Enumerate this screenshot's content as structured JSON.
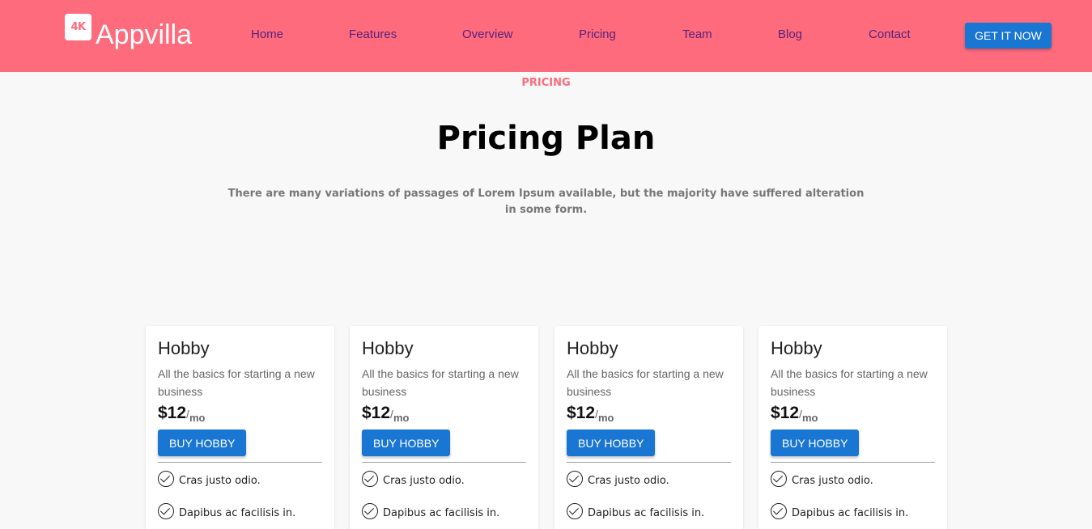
{
  "brand": {
    "logo_text": "4K",
    "name": "Appvilla"
  },
  "nav": {
    "items": [
      {
        "label": "Home"
      },
      {
        "label": "Features"
      },
      {
        "label": "Overview"
      },
      {
        "label": "Pricing"
      },
      {
        "label": "Team"
      },
      {
        "label": "Blog"
      },
      {
        "label": "Contact"
      }
    ],
    "cta_label": "GET IT NOW"
  },
  "section": {
    "eyebrow": "PRICING",
    "title": "Pricing Plan",
    "subtitle": "There are many variations of passages of Lorem Ipsum available, but the majority have suffered alteration in some form."
  },
  "colors": {
    "brand": "#fe6b7d",
    "primary": "#1976d2",
    "nav_text": "#5a2178"
  },
  "plans": [
    {
      "name": "Hobby",
      "description": "All the basics for starting a new business",
      "price": "$12",
      "sep": "/",
      "unit": "mo",
      "button": "BUY HOBBY",
      "features": [
        "Cras justo odio.",
        "Dapibus ac facilisis in."
      ]
    },
    {
      "name": "Hobby",
      "description": "All the basics for starting a new business",
      "price": "$12",
      "sep": "/",
      "unit": "mo",
      "button": "BUY HOBBY",
      "features": [
        "Cras justo odio.",
        "Dapibus ac facilisis in."
      ]
    },
    {
      "name": "Hobby",
      "description": "All the basics for starting a new business",
      "price": "$12",
      "sep": "/",
      "unit": "mo",
      "button": "BUY HOBBY",
      "features": [
        "Cras justo odio.",
        "Dapibus ac facilisis in."
      ]
    },
    {
      "name": "Hobby",
      "description": "All the basics for starting a new business",
      "price": "$12",
      "sep": "/",
      "unit": "mo",
      "button": "BUY HOBBY",
      "features": [
        "Cras justo odio.",
        "Dapibus ac facilisis in."
      ]
    }
  ]
}
